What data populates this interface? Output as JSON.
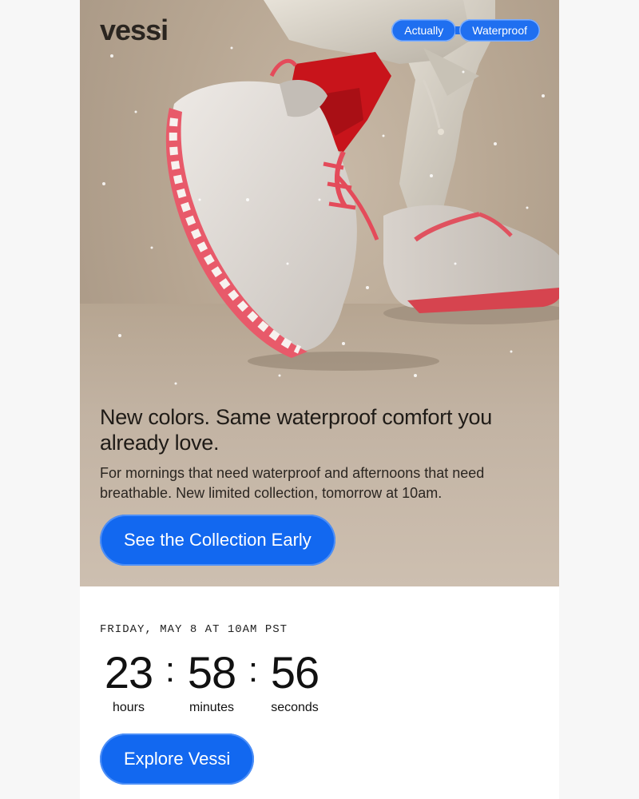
{
  "brand": {
    "logo_text": "vessi"
  },
  "hero": {
    "tag_left": "Actually",
    "tag_right": "Waterproof",
    "headline": "New colors. Same waterproof comfort you already love.",
    "subcopy": "For mornings that need waterproof and afternoons that need breathable. New limited collection, tomorrow at 10am.",
    "cta_label": "See the Collection Early"
  },
  "countdown": {
    "launch_label": "FRIDAY, MAY 8 AT 10AM PST",
    "hours": "23",
    "minutes": "58",
    "seconds": "56",
    "hours_label": "hours",
    "minutes_label": "minutes",
    "seconds_label": "seconds",
    "separator": ":"
  },
  "footer_cta": {
    "label": "Explore Vessi"
  },
  "colors": {
    "accent": "#1268f0",
    "hero_bg": "#b7a692",
    "sock": "#c8141b",
    "sole": "#e85a6a"
  }
}
